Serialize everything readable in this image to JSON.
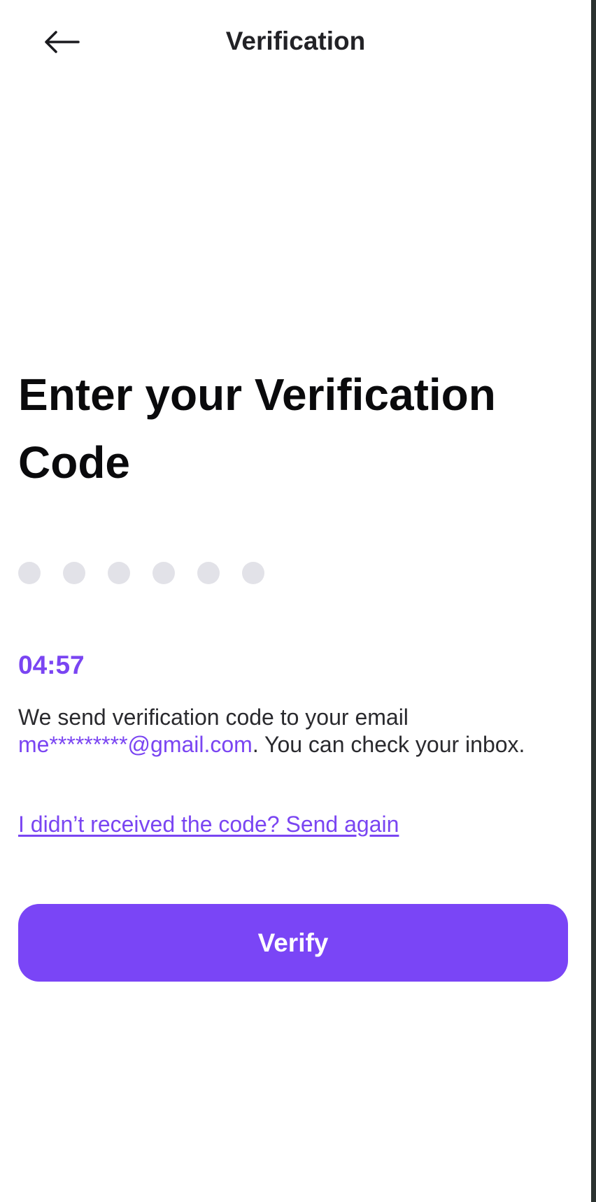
{
  "header": {
    "title": "Verification",
    "back_icon": "arrow-left-icon"
  },
  "heading": "Enter your Verification Code",
  "code": {
    "length": 6,
    "filled": 0
  },
  "timer": "04:57",
  "info": {
    "text_before": "We send verification code to your email ",
    "email": "me*********@gmail.com",
    "text_after": ". You can check your inbox."
  },
  "resend_link": "I didn’t received the code? Send again",
  "verify_button": "Verify",
  "colors": {
    "accent": "#7a45f6",
    "dot_empty": "#e2e2e8",
    "text_dark": "#0a0a0c",
    "background": "#ffffff"
  }
}
